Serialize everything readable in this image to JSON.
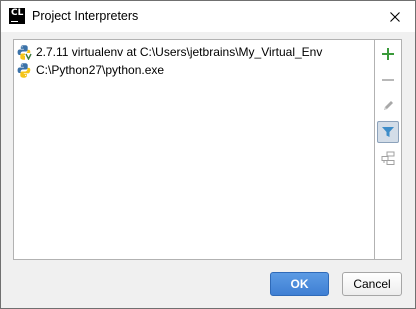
{
  "window": {
    "icon_text": "CL",
    "title": "Project Interpreters"
  },
  "interpreters": [
    {
      "label": "2.7.11 virtualenv at C:\\Users\\jetbrains\\My_Virtual_Env",
      "icon": "python-virtualenv-icon"
    },
    {
      "label": "C:\\Python27\\python.exe",
      "icon": "python-icon"
    }
  ],
  "toolbar": {
    "items": [
      {
        "name": "add-icon",
        "enabled": true
      },
      {
        "name": "remove-icon",
        "enabled": false
      },
      {
        "name": "edit-icon",
        "enabled": false
      },
      {
        "name": "filter-icon",
        "enabled": true,
        "pressed": true
      },
      {
        "name": "show-paths-icon",
        "enabled": false
      }
    ]
  },
  "buttons": {
    "ok_label": "OK",
    "cancel_label": "Cancel"
  },
  "colors": {
    "accent": "#4a8ad9",
    "add_green": "#3a9a3a",
    "filter_blue": "#3d8dc9"
  }
}
